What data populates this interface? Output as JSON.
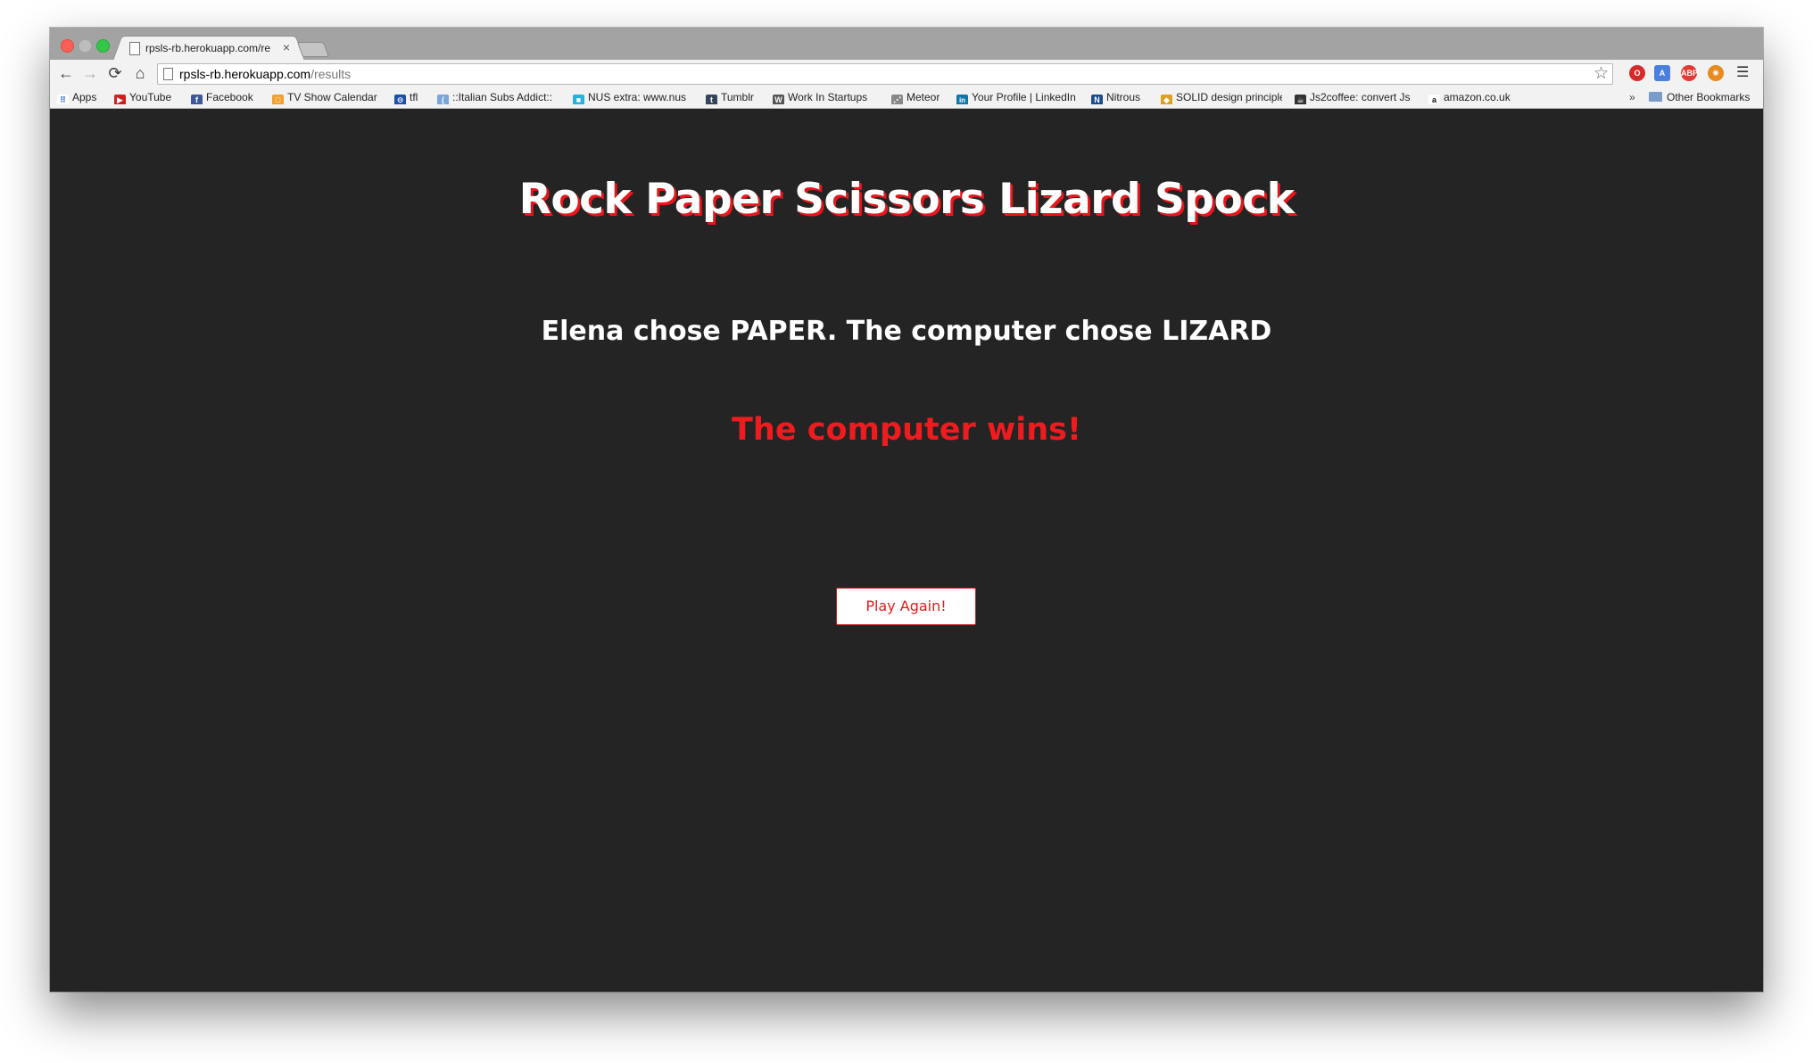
{
  "browser": {
    "tab_title": "rpsls-rb.herokuapp.com/re",
    "tab_close": "×",
    "url_host": "rpsls-rb.herokuapp.com",
    "url_path": "/results",
    "nav": {
      "back": "←",
      "forward": "→",
      "reload": "⟳",
      "home": "⌂"
    },
    "star": "☆",
    "menu": "☰",
    "extensions": [
      "O",
      "A",
      "ABP",
      "✺"
    ],
    "bookmarks": [
      {
        "label": "Apps",
        "icon_color": "#5a8de0",
        "icon": "⠿"
      },
      {
        "label": "YouTube",
        "icon_color": "#d11f1f",
        "icon": "▶"
      },
      {
        "label": "Facebook",
        "icon_color": "#3b5998",
        "icon": "f"
      },
      {
        "label": "TV Show Calendar",
        "icon_color": "#f0a030",
        "icon": "□"
      },
      {
        "label": "tfl",
        "icon_color": "#1d4fa8",
        "icon": "⊖"
      },
      {
        "label": "::Italian Subs Addict::",
        "icon_color": "#7aa6d8",
        "icon": "("
      },
      {
        "label": "NUS extra: www.nus",
        "icon_color": "#25b2dd",
        "icon": "■"
      },
      {
        "label": "Tumblr",
        "icon_color": "#35465c",
        "icon": "t"
      },
      {
        "label": "Work In Startups",
        "icon_color": "#555555",
        "icon": "W"
      },
      {
        "label": "Meteor",
        "icon_color": "#888888",
        "icon": "⋰"
      },
      {
        "label": "Your Profile | LinkedIn",
        "icon_color": "#0e76a8",
        "icon": "in"
      },
      {
        "label": "Nitrous",
        "icon_color": "#1a4b8c",
        "icon": "N"
      },
      {
        "label": "SOLID design principles",
        "icon_color": "#e0a020",
        "icon": "◆"
      },
      {
        "label": "Js2coffee: convert Js",
        "icon_color": "#333333",
        "icon": "☕"
      },
      {
        "label": "amazon.co.uk",
        "icon_color": "#111111",
        "icon": "a"
      }
    ],
    "bookmarks_overflow": "»",
    "other_bookmarks": "Other Bookmarks"
  },
  "page": {
    "title": "Rock Paper Scissors Lizard Spock",
    "choices": "Elena chose PAPER. The computer chose LIZARD",
    "result": "The computer wins!",
    "play_again_label": "Play Again!"
  },
  "colors": {
    "background": "#242424",
    "accent": "#ee1c1f",
    "title_shadow": "#e8161c"
  }
}
